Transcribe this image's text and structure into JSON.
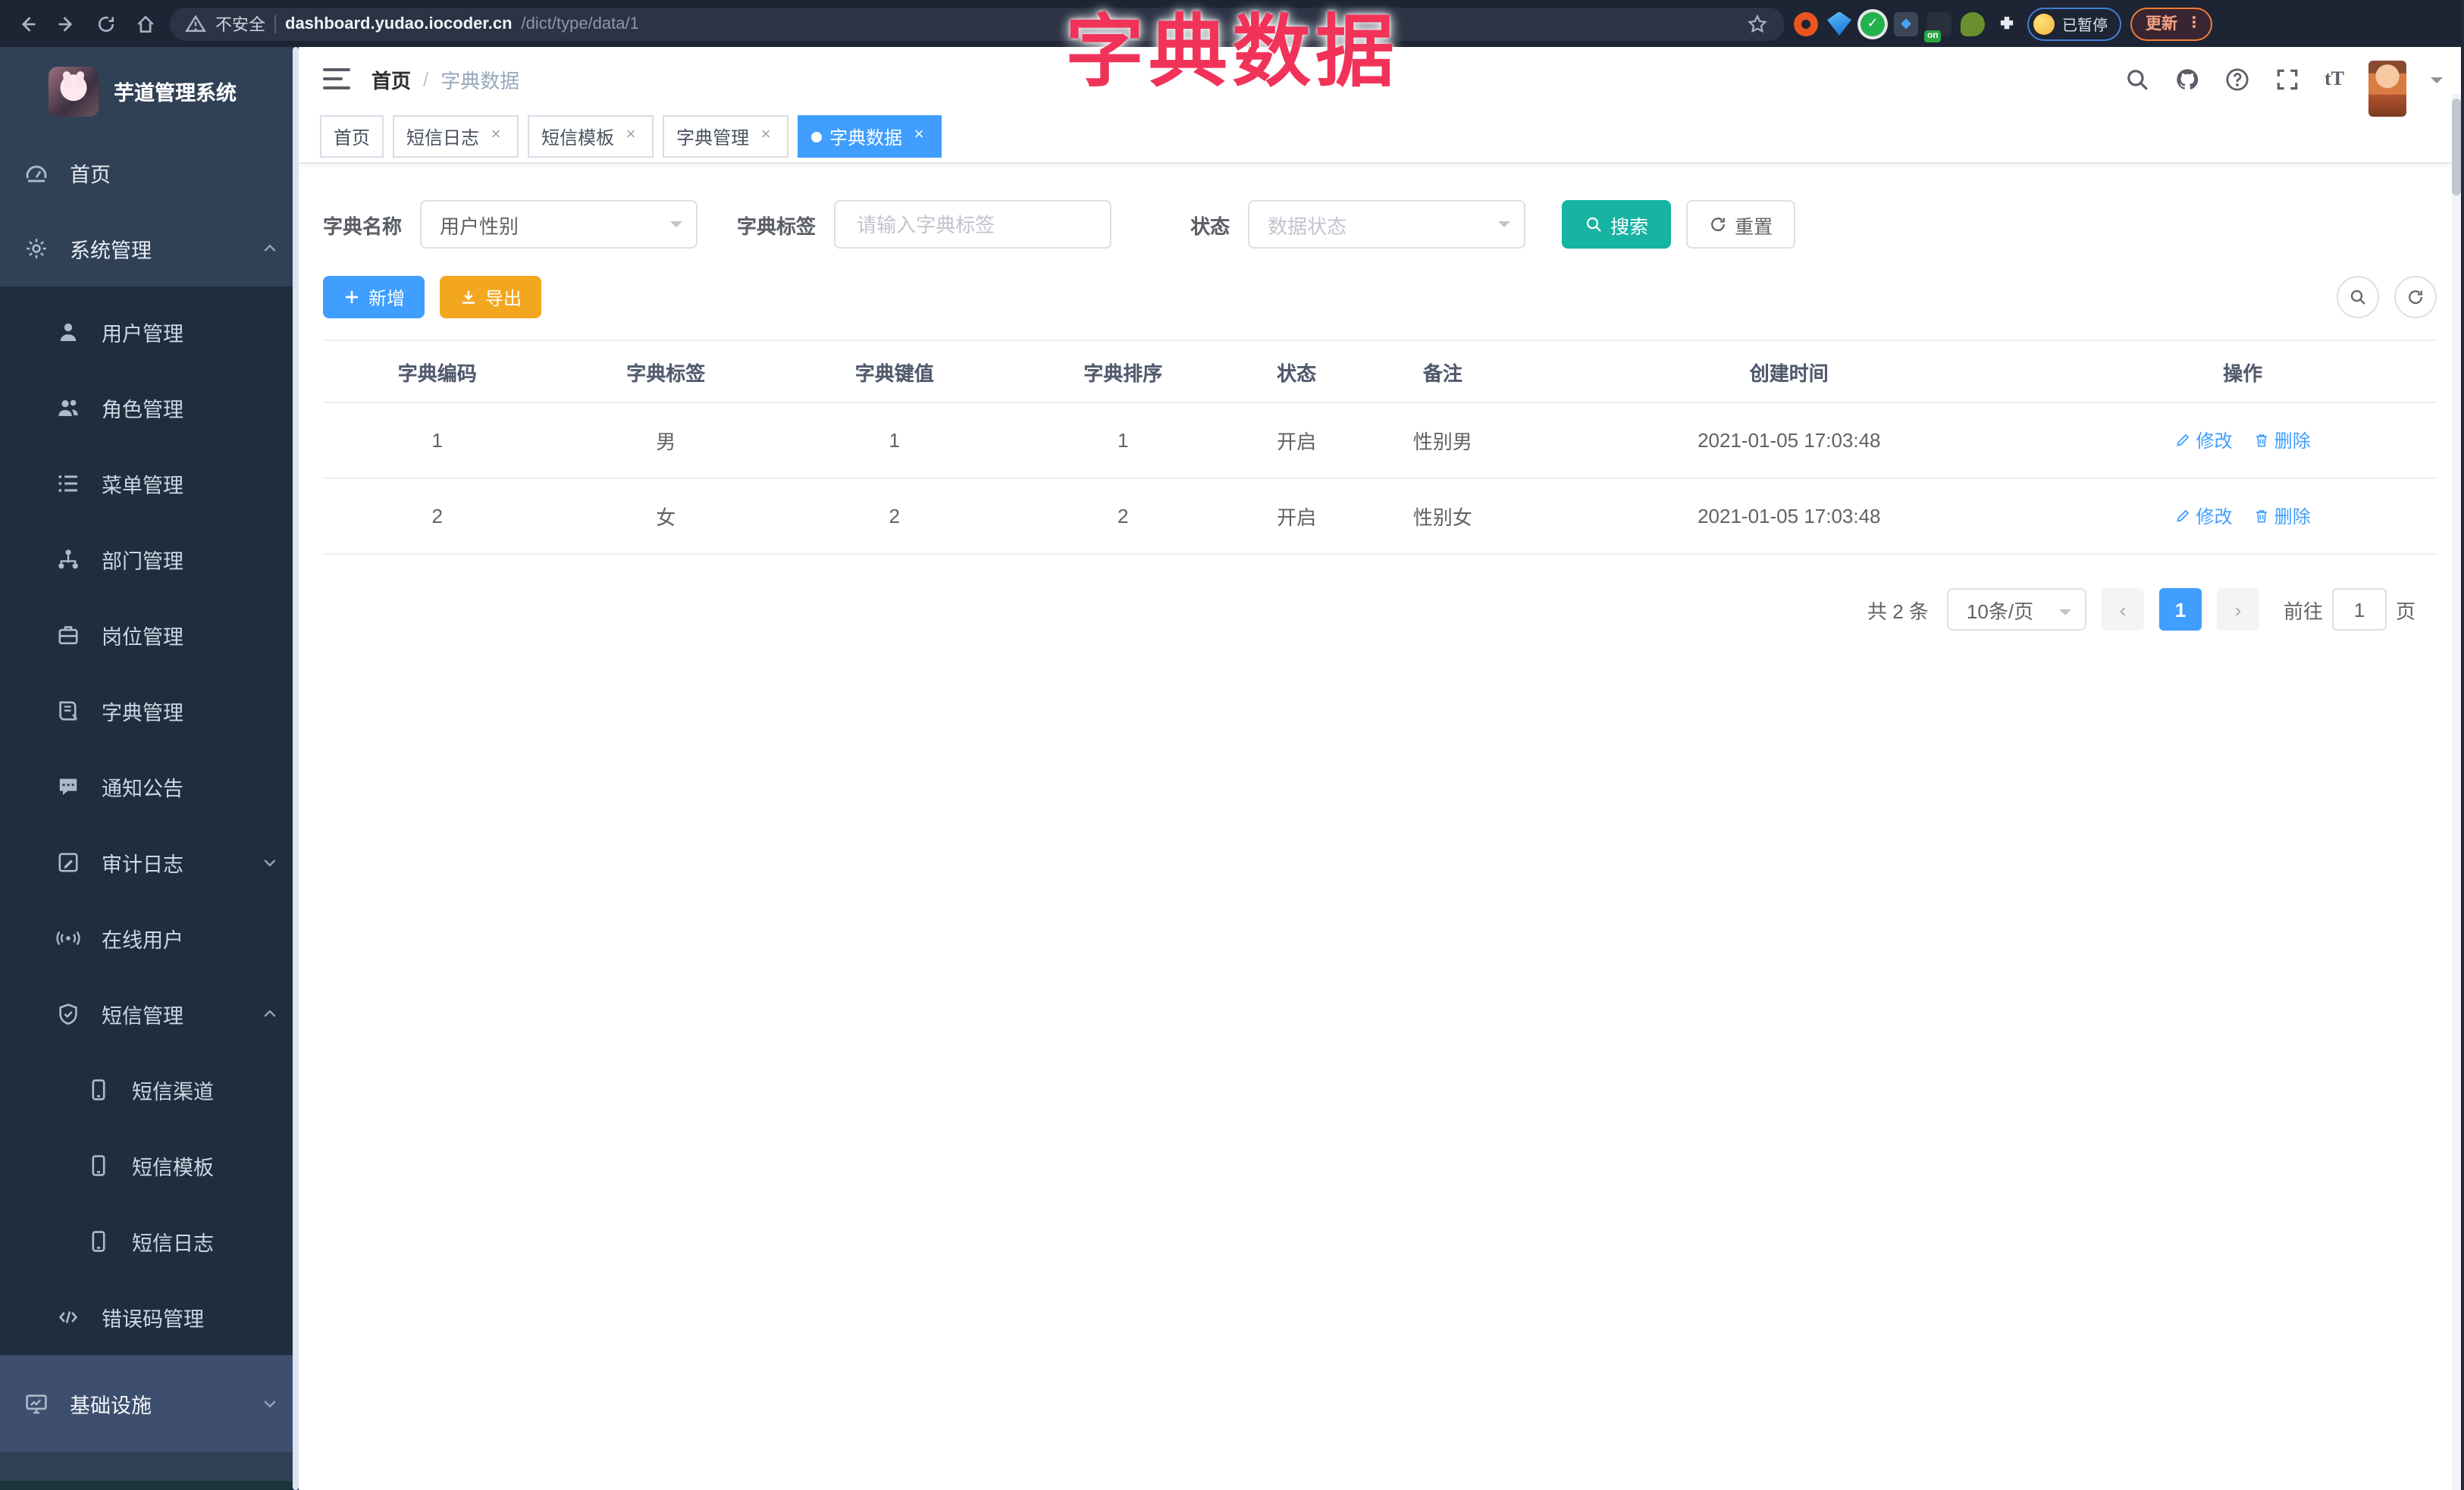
{
  "browser": {
    "not_secure_label": "不安全",
    "url_host": "dashboard.yudao.iocoder.cn",
    "url_path": "/dict/type/data/1",
    "on_badge": "on",
    "paused_label": "已暂停",
    "update_label": "更新",
    "kebab": "⋮"
  },
  "overlay_title": "字典数据",
  "sidebar": {
    "logo_title": "芋道管理系统",
    "items": [
      {
        "label": "首页"
      },
      {
        "label": "系统管理"
      },
      {
        "label": "用户管理"
      },
      {
        "label": "角色管理"
      },
      {
        "label": "菜单管理"
      },
      {
        "label": "部门管理"
      },
      {
        "label": "岗位管理"
      },
      {
        "label": "字典管理"
      },
      {
        "label": "通知公告"
      },
      {
        "label": "审计日志"
      },
      {
        "label": "在线用户"
      },
      {
        "label": "短信管理"
      },
      {
        "label": "短信渠道"
      },
      {
        "label": "短信模板"
      },
      {
        "label": "短信日志"
      },
      {
        "label": "错误码管理"
      },
      {
        "label": "基础设施"
      }
    ]
  },
  "header": {
    "breadcrumb_home": "首页",
    "breadcrumb_sep": "/",
    "breadcrumb_current": "字典数据",
    "font_icon": "tT"
  },
  "tabs": [
    {
      "label": "首页"
    },
    {
      "label": "短信日志"
    },
    {
      "label": "短信模板"
    },
    {
      "label": "字典管理"
    },
    {
      "label": "字典数据"
    }
  ],
  "filters": {
    "name_label": "字典名称",
    "name_value": "用户性别",
    "tag_label": "字典标签",
    "tag_placeholder": "请输入字典标签",
    "status_label": "状态",
    "status_placeholder": "数据状态",
    "search_label": "搜索",
    "reset_label": "重置"
  },
  "toolbar": {
    "add_label": "新增",
    "export_label": "导出"
  },
  "table": {
    "columns": [
      "字典编码",
      "字典标签",
      "字典键值",
      "字典排序",
      "状态",
      "备注",
      "创建时间",
      "操作"
    ],
    "rows": [
      {
        "code": "1",
        "label": "男",
        "value": "1",
        "sort": "1",
        "status": "开启",
        "remark": "性别男",
        "created_at": "2021-01-05 17:03:48"
      },
      {
        "code": "2",
        "label": "女",
        "value": "2",
        "sort": "2",
        "status": "开启",
        "remark": "性别女",
        "created_at": "2021-01-05 17:03:48"
      }
    ],
    "edit_label": "修改",
    "delete_label": "删除"
  },
  "pagination": {
    "total_label": "共 2 条",
    "page_size_label": "10条/页",
    "current_page": "1",
    "goto_label": "前往",
    "goto_value": "1",
    "page_unit": "页"
  },
  "colors": {
    "accent_blue": "#409eff",
    "teal": "#17b3a3",
    "amber": "#f3a71f",
    "overlay_red": "#f1335a",
    "sidebar_bg": "#304156",
    "submenu_bg": "#1f2d3d"
  }
}
